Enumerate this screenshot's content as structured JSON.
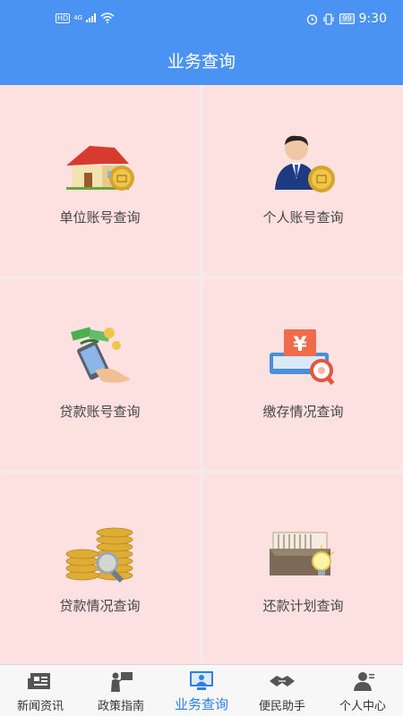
{
  "status_bar": {
    "left_badge": "HD",
    "network": "4G",
    "battery": "99",
    "time": "9:30"
  },
  "header": {
    "title": "业务查询"
  },
  "tiles": [
    {
      "label": "单位账号查询",
      "icon": "house-coin-icon"
    },
    {
      "label": "个人账号查询",
      "icon": "person-coin-icon"
    },
    {
      "label": "贷款账号查询",
      "icon": "phone-money-icon"
    },
    {
      "label": "缴存情况查询",
      "icon": "yuan-tray-search-icon"
    },
    {
      "label": "贷款情况查询",
      "icon": "coin-stack-magnifier-icon"
    },
    {
      "label": "还款计划查询",
      "icon": "file-box-bulb-icon"
    }
  ],
  "tabs": [
    {
      "label": "新闻资讯",
      "icon": "newspaper-icon",
      "active": false
    },
    {
      "label": "政策指南",
      "icon": "presenter-icon",
      "active": false
    },
    {
      "label": "业务查询",
      "icon": "monitor-user-icon",
      "active": true
    },
    {
      "label": "便民助手",
      "icon": "handshake-icon",
      "active": false
    },
    {
      "label": "个人中心",
      "icon": "user-icon",
      "active": false
    }
  ],
  "colors": {
    "header": "#4b93f3",
    "tile_bg": "#fde1e1",
    "active_tab": "#2f7fe6"
  }
}
